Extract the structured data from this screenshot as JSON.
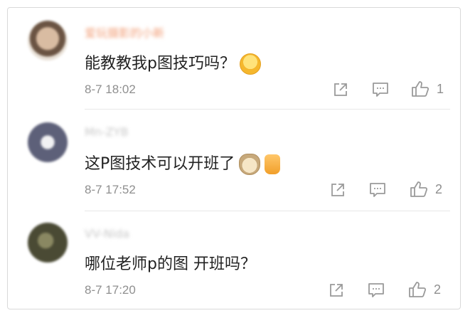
{
  "comments": [
    {
      "username": "爱玩摄影的小新",
      "text": "能教教我p图技巧吗？",
      "emojis": [
        "laughing-crying-icon"
      ],
      "time": "8-7 18:02",
      "like_count": "1"
    },
    {
      "username": "Mn-ZYB",
      "text": "这P图技术可以开班了",
      "emojis": [
        "cat-face-icon",
        "thumbs-up-icon"
      ],
      "time": "8-7 17:52",
      "like_count": "2"
    },
    {
      "username": "VV-Nida",
      "text": "哪位老师p的图 开班吗？",
      "emojis": [],
      "time": "8-7 17:20",
      "like_count": "2"
    }
  ],
  "colors": {
    "text": "#222222",
    "meta": "#8f8f8f",
    "icon": "#9a9a9a",
    "divider": "#e8e8e8"
  }
}
